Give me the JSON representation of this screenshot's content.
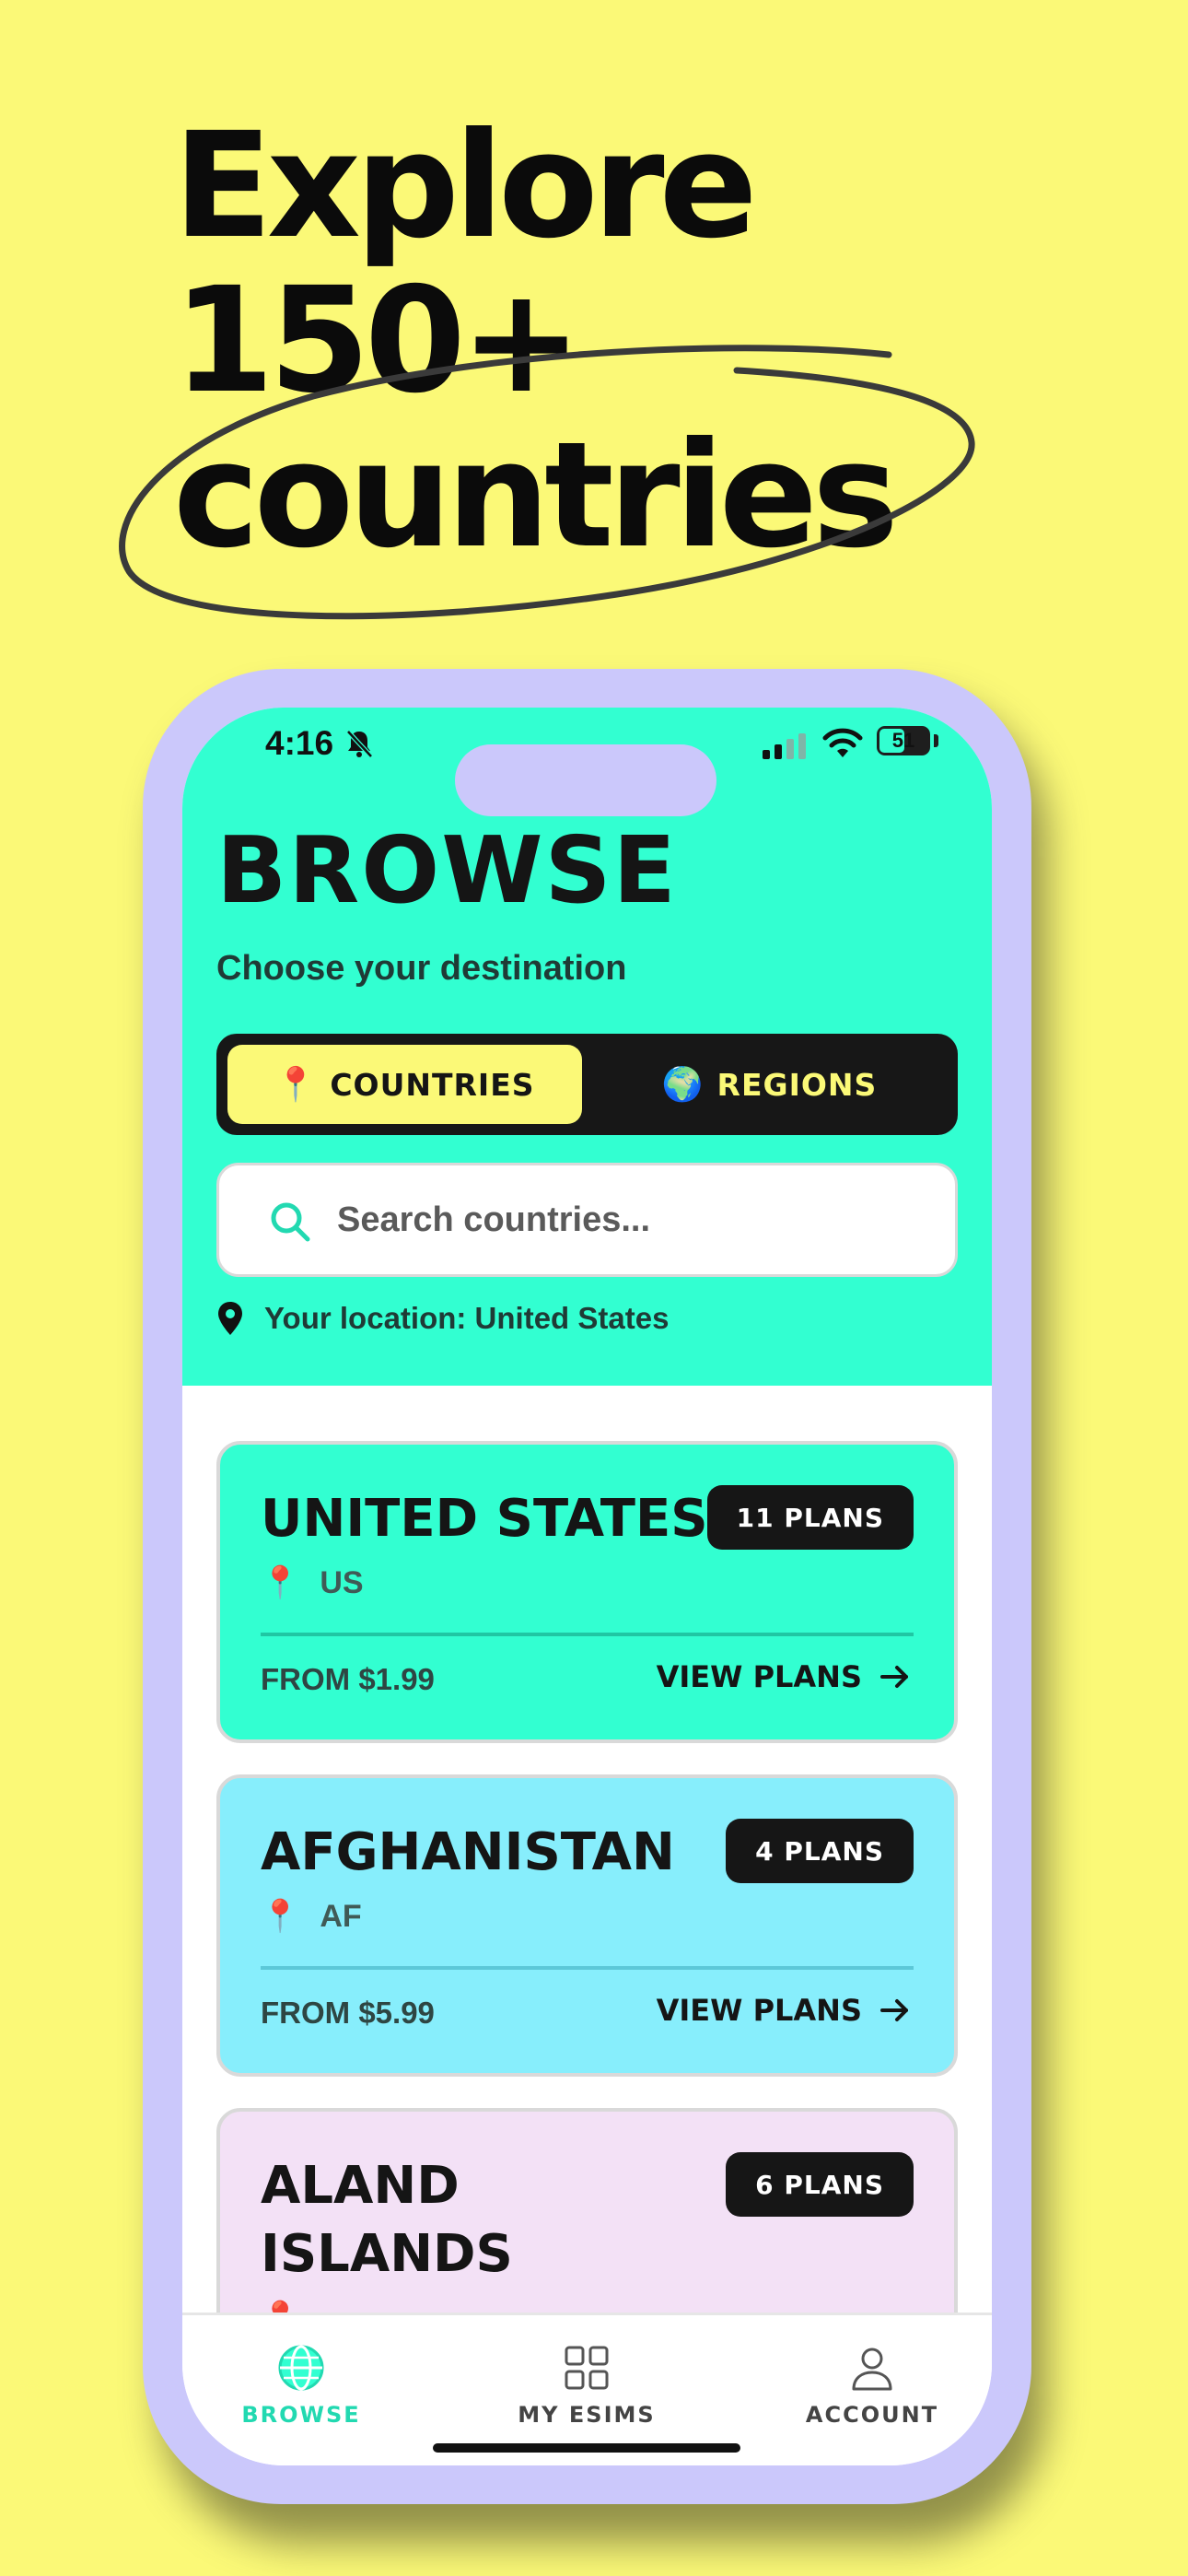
{
  "headline": {
    "line1": "Explore",
    "line2": "150+",
    "line3": "countries"
  },
  "status_bar": {
    "time": "4:16",
    "battery": "51",
    "battery_level": 0.51
  },
  "header": {
    "title": "BROWSE",
    "subtitle": "Choose your destination"
  },
  "segmented": {
    "countries": {
      "emoji": "📍",
      "label": "COUNTRIES",
      "selected": true
    },
    "regions": {
      "emoji": "🌍",
      "label": "REGIONS",
      "selected": false
    }
  },
  "search": {
    "placeholder": "Search countries..."
  },
  "location": {
    "text": "Your location: United States"
  },
  "cards": [
    {
      "name": "UNITED STATES",
      "plans": "11 PLANS",
      "flag_emoji": "📍",
      "code": "US",
      "from": "FROM $1.99",
      "cta": "VIEW PLANS",
      "color": "#32FFD1",
      "divider": "#20c7a3"
    },
    {
      "name": "AFGHANISTAN",
      "plans": "4 PLANS",
      "flag_emoji": "📍",
      "code": "AF",
      "from": "FROM $5.99",
      "cta": "VIEW PLANS",
      "color": "#87EEFC",
      "divider": "#5cc8d8"
    },
    {
      "name_line1": "ALAND",
      "name_line2": "ISLANDS",
      "plans": "6 PLANS",
      "flag_emoji": "📍",
      "color": "#F3E1F6"
    }
  ],
  "tabbar": {
    "browse": {
      "label": "BROWSE",
      "icon": "globe-icon",
      "active": true
    },
    "my_esims": {
      "label": "MY ESIMS",
      "icon": "grid-icon",
      "active": false
    },
    "account": {
      "label": "ACCOUNT",
      "icon": "person-icon",
      "active": false
    }
  },
  "colors": {
    "background": "#FBF977",
    "accent": "#32FFD1",
    "phone_frame": "#CBC8FB",
    "dark": "#171717"
  }
}
